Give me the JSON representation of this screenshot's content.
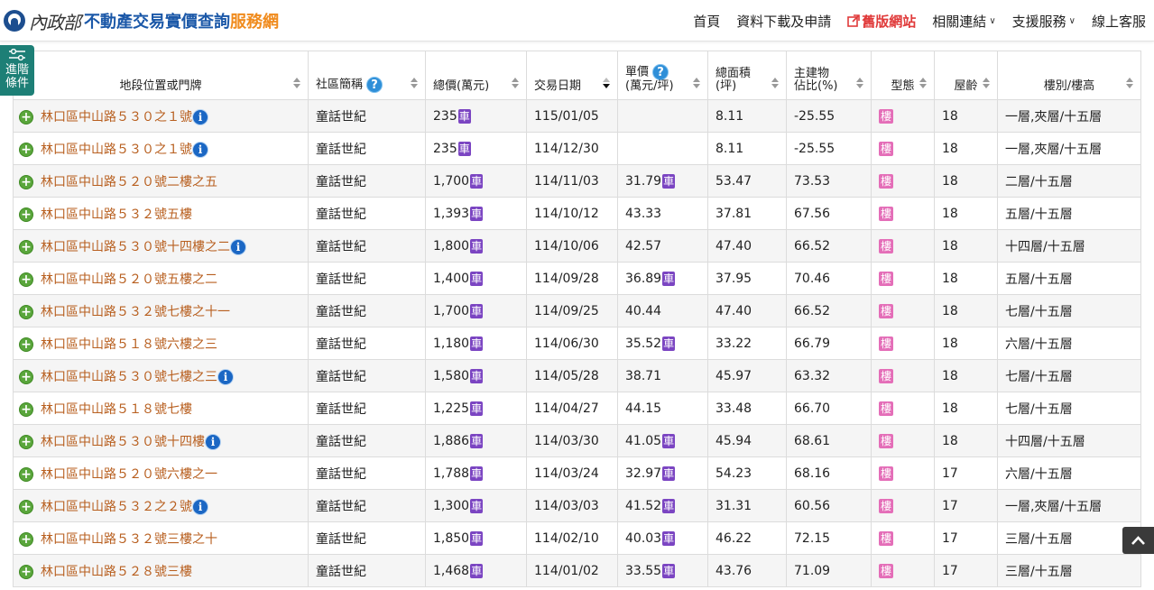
{
  "header": {
    "brand": "內政部",
    "title_main": "不動產交易實價查詢",
    "title_accent": "服務網",
    "nav": [
      {
        "label": "首頁",
        "highlight": false,
        "dropdown": false
      },
      {
        "label": "資料下載及申請",
        "highlight": false,
        "dropdown": false
      },
      {
        "label": "舊版網站",
        "highlight": true,
        "dropdown": false
      },
      {
        "label": "相關連結",
        "highlight": false,
        "dropdown": true
      },
      {
        "label": "支援服務",
        "highlight": false,
        "dropdown": true
      },
      {
        "label": "線上客服",
        "highlight": false,
        "dropdown": false
      }
    ]
  },
  "filter_tab": {
    "line1": "進階",
    "line2": "條件"
  },
  "table": {
    "columns": [
      {
        "key": "address",
        "line1": "地段位置或門牌",
        "line2": ""
      },
      {
        "key": "community",
        "line1": "社區簡稱",
        "line2": ""
      },
      {
        "key": "total_price",
        "line1": "總價(萬元)",
        "line2": ""
      },
      {
        "key": "date",
        "line1": "交易日期",
        "line2": ""
      },
      {
        "key": "unit_price",
        "line1": "單價",
        "line2": "(萬元/坪)"
      },
      {
        "key": "area",
        "line1": "總面積",
        "line2": "(坪)"
      },
      {
        "key": "main_ratio",
        "line1": "主建物",
        "line2": "佔比(%)"
      },
      {
        "key": "type",
        "line1": "型態",
        "line2": ""
      },
      {
        "key": "age",
        "line1": "屋齡",
        "line2": ""
      },
      {
        "key": "floor",
        "line1": "樓別/樓高",
        "line2": ""
      }
    ],
    "badges": {
      "car": "車",
      "type": "樓",
      "info": "i",
      "help": "?",
      "plus": "+"
    },
    "rows": [
      {
        "address": "林口區中山路５３０之１號",
        "info": true,
        "community": "童話世紀",
        "total_price": "235",
        "car": true,
        "date": "115/01/05",
        "unit_price": "",
        "unit_car": false,
        "area": "8.11",
        "main_ratio": "-25.55",
        "age": "18",
        "floor": "一層,夾層/十五層"
      },
      {
        "address": "林口區中山路５３０之１號",
        "info": true,
        "community": "童話世紀",
        "total_price": "235",
        "car": true,
        "date": "114/12/30",
        "unit_price": "",
        "unit_car": false,
        "area": "8.11",
        "main_ratio": "-25.55",
        "age": "18",
        "floor": "一層,夾層/十五層"
      },
      {
        "address": "林口區中山路５２０號二樓之五",
        "info": false,
        "community": "童話世紀",
        "total_price": "1,700",
        "car": true,
        "date": "114/11/03",
        "unit_price": "31.79",
        "unit_car": true,
        "area": "53.47",
        "main_ratio": "73.53",
        "age": "18",
        "floor": "二層/十五層"
      },
      {
        "address": "林口區中山路５３２號五樓",
        "info": false,
        "community": "童話世紀",
        "total_price": "1,393",
        "car": true,
        "date": "114/10/12",
        "unit_price": "43.33",
        "unit_car": false,
        "area": "37.81",
        "main_ratio": "67.56",
        "age": "18",
        "floor": "五層/十五層"
      },
      {
        "address": "林口區中山路５３０號十四樓之二",
        "info": true,
        "community": "童話世紀",
        "total_price": "1,800",
        "car": true,
        "date": "114/10/06",
        "unit_price": "42.57",
        "unit_car": false,
        "area": "47.40",
        "main_ratio": "66.52",
        "age": "18",
        "floor": "十四層/十五層"
      },
      {
        "address": "林口區中山路５２０號五樓之二",
        "info": false,
        "community": "童話世紀",
        "total_price": "1,400",
        "car": true,
        "date": "114/09/28",
        "unit_price": "36.89",
        "unit_car": true,
        "area": "37.95",
        "main_ratio": "70.46",
        "age": "18",
        "floor": "五層/十五層"
      },
      {
        "address": "林口區中山路５３２號七樓之十一",
        "info": false,
        "community": "童話世紀",
        "total_price": "1,700",
        "car": true,
        "date": "114/09/25",
        "unit_price": "40.44",
        "unit_car": false,
        "area": "47.40",
        "main_ratio": "66.52",
        "age": "18",
        "floor": "七層/十五層"
      },
      {
        "address": "林口區中山路５１８號六樓之三",
        "info": false,
        "community": "童話世紀",
        "total_price": "1,180",
        "car": true,
        "date": "114/06/30",
        "unit_price": "35.52",
        "unit_car": true,
        "area": "33.22",
        "main_ratio": "66.79",
        "age": "18",
        "floor": "六層/十五層"
      },
      {
        "address": "林口區中山路５３０號七樓之三",
        "info": true,
        "community": "童話世紀",
        "total_price": "1,580",
        "car": true,
        "date": "114/05/28",
        "unit_price": "38.71",
        "unit_car": false,
        "area": "45.97",
        "main_ratio": "63.32",
        "age": "18",
        "floor": "七層/十五層"
      },
      {
        "address": "林口區中山路５１８號七樓",
        "info": false,
        "community": "童話世紀",
        "total_price": "1,225",
        "car": true,
        "date": "114/04/27",
        "unit_price": "44.15",
        "unit_car": false,
        "area": "33.48",
        "main_ratio": "66.70",
        "age": "18",
        "floor": "七層/十五層"
      },
      {
        "address": "林口區中山路５３０號十四樓",
        "info": true,
        "community": "童話世紀",
        "total_price": "1,886",
        "car": true,
        "date": "114/03/30",
        "unit_price": "41.05",
        "unit_car": true,
        "area": "45.94",
        "main_ratio": "68.61",
        "age": "18",
        "floor": "十四層/十五層"
      },
      {
        "address": "林口區中山路５２０號六樓之一",
        "info": false,
        "community": "童話世紀",
        "total_price": "1,788",
        "car": true,
        "date": "114/03/24",
        "unit_price": "32.97",
        "unit_car": true,
        "area": "54.23",
        "main_ratio": "68.16",
        "age": "17",
        "floor": "六層/十五層"
      },
      {
        "address": "林口區中山路５３２之２號",
        "info": true,
        "community": "童話世紀",
        "total_price": "1,300",
        "car": true,
        "date": "114/03/03",
        "unit_price": "41.52",
        "unit_car": true,
        "area": "31.31",
        "main_ratio": "60.56",
        "age": "17",
        "floor": "一層,夾層/十五層"
      },
      {
        "address": "林口區中山路５３２號三樓之十",
        "info": false,
        "community": "童話世紀",
        "total_price": "1,850",
        "car": true,
        "date": "114/02/10",
        "unit_price": "40.03",
        "unit_car": true,
        "area": "46.22",
        "main_ratio": "72.15",
        "age": "17",
        "floor": "三層/十五層"
      },
      {
        "address": "林口區中山路５２８號三樓",
        "info": false,
        "community": "童話世紀",
        "total_price": "1,468",
        "car": true,
        "date": "114/01/02",
        "unit_price": "33.55",
        "unit_car": true,
        "area": "43.76",
        "main_ratio": "71.09",
        "age": "17",
        "floor": "三層/十五層"
      }
    ]
  },
  "colors": {
    "brand_blue": "#1b58a8",
    "accent_orange": "#f08b1d",
    "address_link": "#b85f1f",
    "car_badge": "#7b45c2",
    "type_badge": "#e46eb8",
    "filter_tab": "#1d7f76",
    "nav_highlight": "#e03a3a"
  }
}
